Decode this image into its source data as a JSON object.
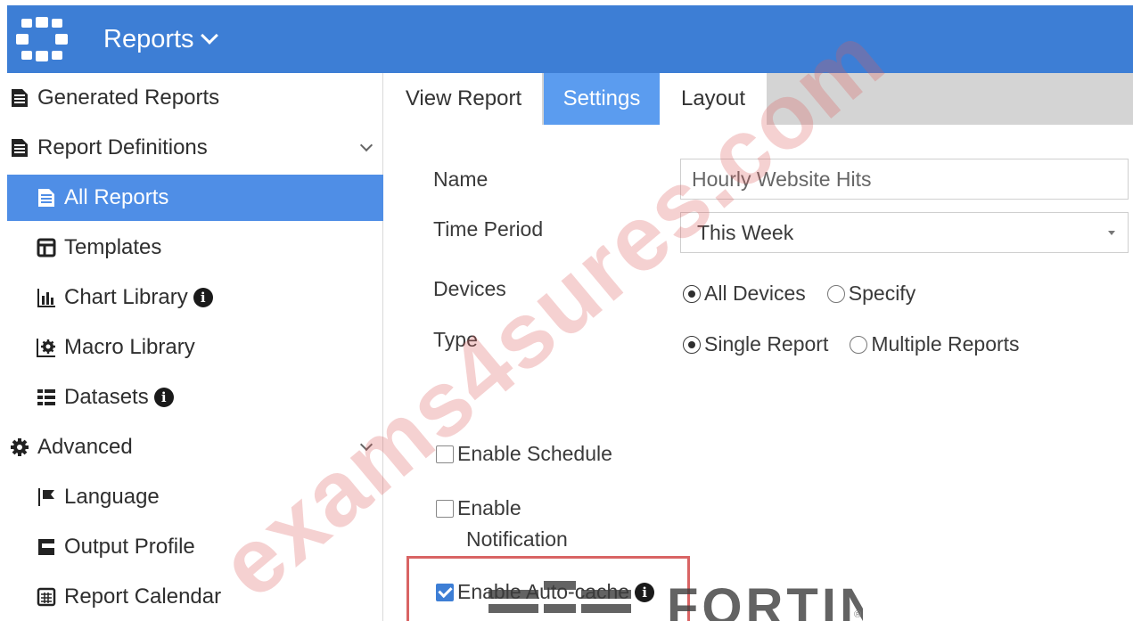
{
  "header": {
    "title": "Reports",
    "logo_icon": "grid-logo-icon",
    "color": "#3d7ed5"
  },
  "sidebar": {
    "items": [
      {
        "label": "Generated Reports",
        "icon": "document-icon"
      },
      {
        "label": "Report Definitions",
        "icon": "document-icon"
      },
      {
        "label": "All Reports",
        "icon": "document-icon",
        "active": true
      },
      {
        "label": "Templates",
        "icon": "template-icon"
      },
      {
        "label": "Chart Library",
        "icon": "bar-chart-icon"
      },
      {
        "label": "Macro Library",
        "icon": "gear-icon"
      },
      {
        "label": "Datasets",
        "icon": "database-icon"
      },
      {
        "label": "Advanced",
        "icon": "cog-icon"
      },
      {
        "label": "Language",
        "icon": "flag-icon"
      },
      {
        "label": "Output Profile",
        "icon": "output-icon"
      },
      {
        "label": "Report Calendar",
        "icon": "calendar-icon"
      }
    ],
    "active_color": "#4f8ee6"
  },
  "tabs": [
    {
      "label": "View Report"
    },
    {
      "label": "Settings",
      "active": true
    },
    {
      "label": "Layout"
    }
  ],
  "form": {
    "name_label": "Name",
    "name_value": "Hourly Website Hits",
    "time_period_label": "Time Period",
    "time_period_value": "This Week",
    "devices_label": "Devices",
    "devices_options": [
      "All Devices",
      "Specify"
    ],
    "devices_selected": "All Devices",
    "type_label": "Type",
    "type_options": [
      "Single Report",
      "Multiple Reports"
    ],
    "type_selected": "Single Report",
    "enable_schedule": {
      "label": "Enable Schedule",
      "checked": false
    },
    "enable_notification": {
      "label_line1": "Enable",
      "label_line2": "Notification",
      "checked": false
    },
    "enable_auto_cache": {
      "label": "Enable Auto-cache",
      "checked": true
    }
  },
  "watermark": "exams4sures.com",
  "brand": "FORTINET"
}
